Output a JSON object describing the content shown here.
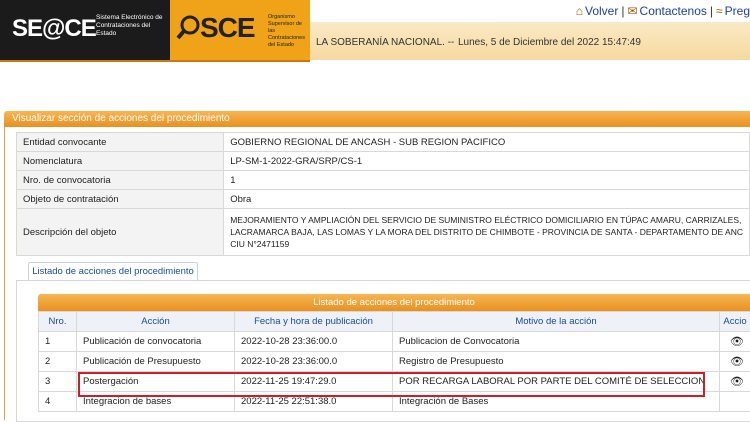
{
  "header": {
    "seace_logo": "SE@CE",
    "seace_subtitle": "Sistema Electrónico de Contrataciones del Estado",
    "osce_logo": "SCE",
    "osce_subtitle": "Organismo Supervisor de las Contrataciones del Estado",
    "links": {
      "volver": "Volver",
      "contactenos": "Contactenos",
      "preguntas": "Preg"
    },
    "marquee": "LA SOBERANÍA NACIONAL. --",
    "datetime": "Lunes, 5 de Diciembre del 2022  15:47:49"
  },
  "panel": {
    "title": "Visualizar sección de acciones del procedimiento",
    "rows": [
      {
        "label": "Entidad convocante",
        "value": "GOBIERNO REGIONAL DE ANCASH - SUB REGION PACIFICO"
      },
      {
        "label": "Nomenclatura",
        "value": "LP-SM-1-2022-GRA/SRP/CS-1"
      },
      {
        "label": "Nro. de convocatoria",
        "value": "1"
      },
      {
        "label": "Objeto de contratación",
        "value": "Obra"
      }
    ],
    "description": {
      "label": "Descripción del objeto",
      "line1": "MEJORAMIENTO Y AMPLIACIÓN DEL SERVICIO DE SUMINISTRO ELÉCTRICO DOMICILIARIO EN TÚPAC AMARU, CARRIZALES,",
      "line2": "LACRAMARCA BAJA, LAS LOMAS Y LA MORA DEL DISTRITO DE CHIMBOTE - PROVINCIA DE SANTA - DEPARTAMENTO DE ANC",
      "line3": "CIU N°2471159"
    }
  },
  "list": {
    "tab_label": "Listado de acciones del procedimiento",
    "title": "Listado de acciones del procedimiento",
    "columns": {
      "nro": "Nro.",
      "accion": "Acción",
      "fecha": "Fecha y hora de publicación",
      "motivo": "Motivo de la acción",
      "acc": "Accio"
    },
    "rows": [
      {
        "nro": "1",
        "accion": "Publicación de convocatoria",
        "fecha": "2022-10-28 23:36:00.0",
        "motivo": "Publicacion de Convocatoria"
      },
      {
        "nro": "2",
        "accion": "Publicación de Presupuesto",
        "fecha": "2022-10-28 23:36:00.0",
        "motivo": "Registro de Presupuesto"
      },
      {
        "nro": "3",
        "accion": "Postergación",
        "fecha": "2022-11-25 19:47:29.0",
        "motivo": "POR RECARGA LABORAL POR PARTE DEL COMITÉ DE SELECCION"
      },
      {
        "nro": "4",
        "accion": "Integracion de bases",
        "fecha": "2022-11-25 22:51:38.0",
        "motivo": "Integración de Bases"
      }
    ]
  }
}
